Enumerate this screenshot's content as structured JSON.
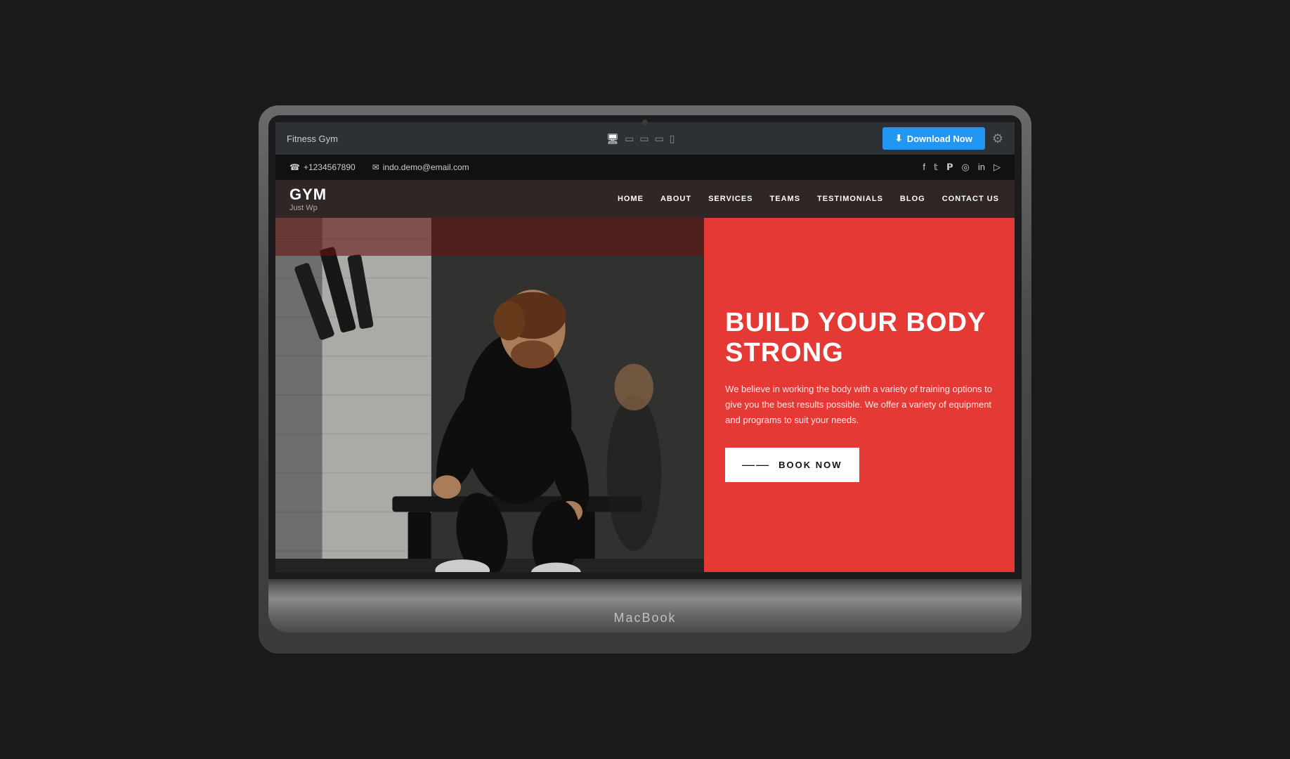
{
  "toolbar": {
    "title": "Fitness Gym",
    "download_label": "Download Now",
    "download_icon": "⬇",
    "device_icons": [
      "🖥",
      "□",
      "□",
      "□",
      "📱"
    ]
  },
  "contact_bar": {
    "phone": "+1234567890",
    "email": "indo.demo@email.com",
    "phone_icon": "☎",
    "email_icon": "✉",
    "social_icons": [
      "f",
      "𝕏",
      "𝐏",
      "📷",
      "in",
      "▶"
    ]
  },
  "nav": {
    "logo": "GYM",
    "logo_sub": "Just Wp",
    "links": [
      "HOME",
      "ABOUT",
      "SERVICES",
      "TEAMS",
      "TESTIMONIALS",
      "BLOG",
      "CONTACT US"
    ]
  },
  "hero": {
    "title_line1": "BUILD YOUR BODY",
    "title_line2": "STRONG",
    "description": "We believe in working the body with a variety of training options to give you the best results possible. We offer a variety of equipment and programs to suit your needs.",
    "cta_label": "BOOK NOW",
    "cta_arrow": "——"
  },
  "macbook": {
    "label": "MacBook"
  }
}
